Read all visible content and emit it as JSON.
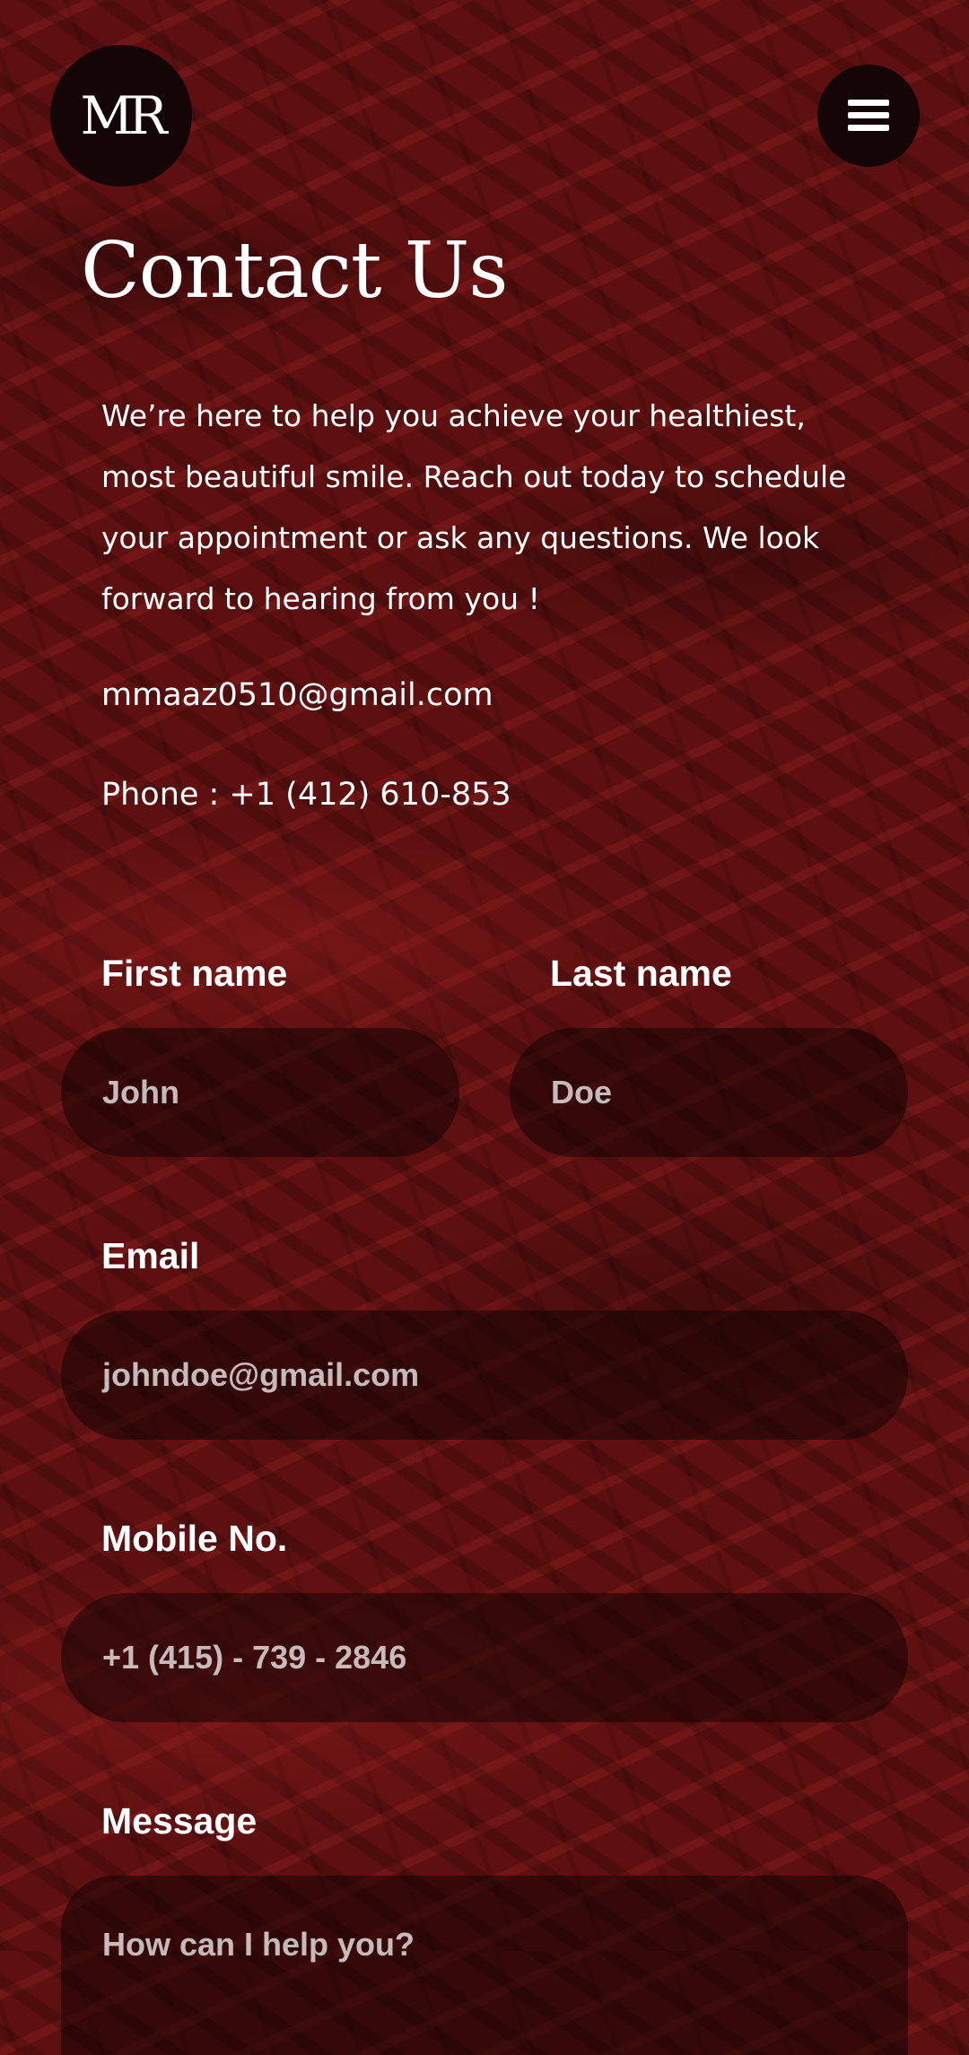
{
  "header": {
    "logo_text": "MR",
    "menu_icon": "hamburger-menu-icon"
  },
  "page": {
    "title": "Contact Us",
    "intro": "We’re here to help you achieve your healthiest, most beautiful smile. Reach out today to schedule your appointment or ask any questions. We look forward to hearing from you !",
    "email": "mmaaz0510@gmail.com",
    "phone": "Phone : +1 (412) 610-853"
  },
  "form": {
    "first_name": {
      "label": "First name",
      "placeholder": "John"
    },
    "last_name": {
      "label": "Last name",
      "placeholder": "Doe"
    },
    "email": {
      "label": "Email",
      "placeholder": "johndoe@gmail.com"
    },
    "mobile": {
      "label": "Mobile No.",
      "placeholder": "+1 (415) - 739 - 2846"
    },
    "message": {
      "label": "Message",
      "placeholder": "How can I help you?"
    }
  },
  "colors": {
    "background": "#5e1010",
    "surface": "#140606",
    "text": "#ffffff"
  }
}
